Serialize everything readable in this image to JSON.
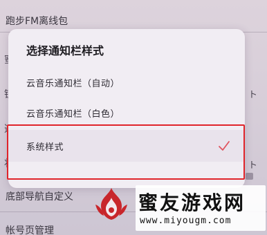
{
  "background": {
    "top_item": "跑步FM离线包",
    "nav_item": "底部导航自定义",
    "account_item": "帐号页管理",
    "edge_glyphs": [
      "蜜",
      "锐",
      "选",
      "状"
    ],
    "right_glyphs": [
      "ト",
      "ト"
    ]
  },
  "dialog": {
    "title": "选择通知栏样式",
    "options": [
      {
        "label": "云音乐通知栏（自动）",
        "selected": false
      },
      {
        "label": "云音乐通知栏（白色）",
        "selected": false
      },
      {
        "label": "系统样式",
        "selected": true
      }
    ],
    "check_icon": "checkmark-icon",
    "accent_color": "#e0535e"
  },
  "annotation": {
    "highlight_color": "#e0242a"
  },
  "watermark": {
    "name": "蜜友游戏网",
    "url": "www.miyougm.com",
    "logo_icon": "flame-logo-icon",
    "logo_color": "#c8262b"
  }
}
